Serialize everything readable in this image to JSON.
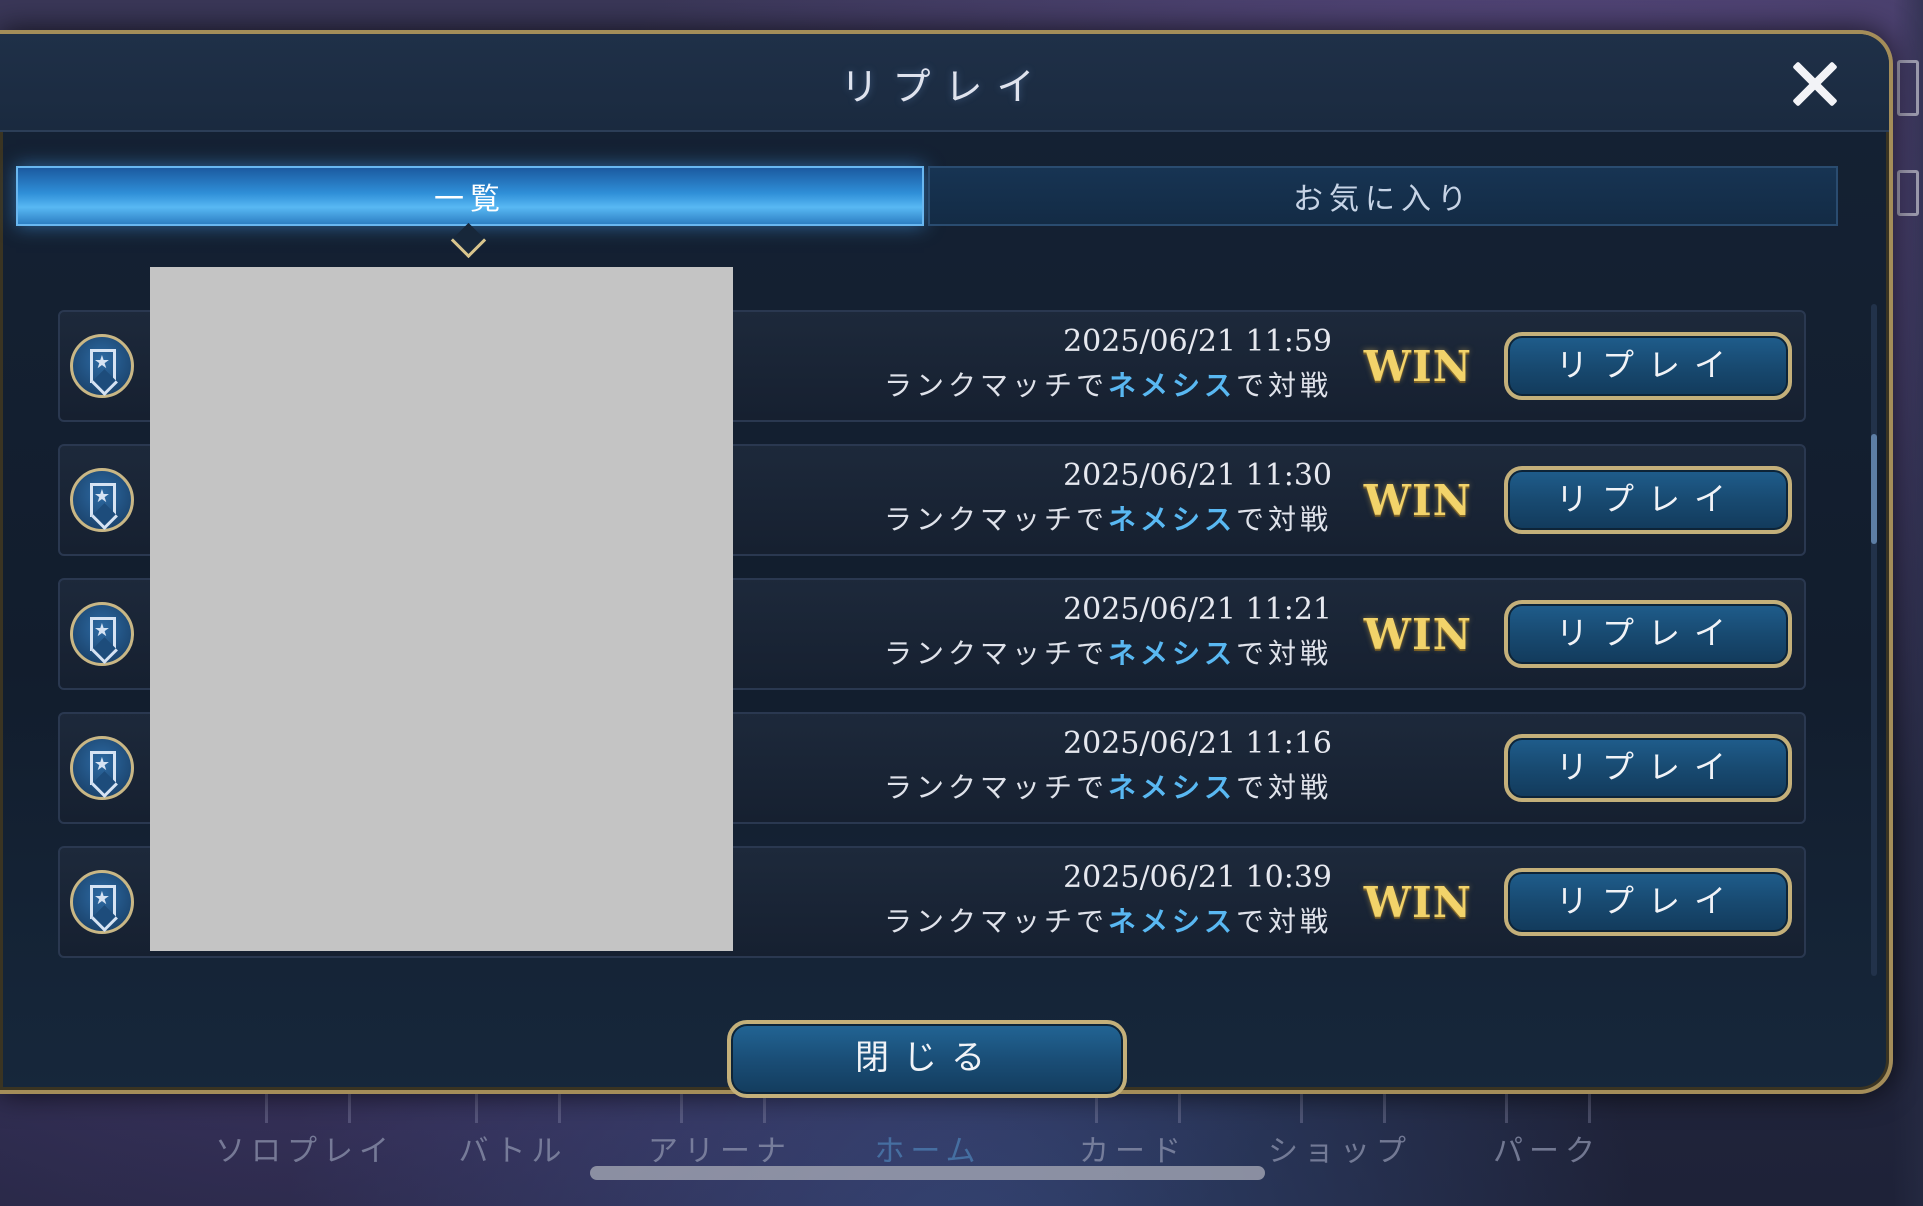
{
  "modal": {
    "title": "リプレイ",
    "close_icon": "close-icon",
    "tabs": [
      {
        "label": "一覧",
        "active": true
      },
      {
        "label": "お気に入り",
        "active": false
      }
    ],
    "rows": [
      {
        "date": "2025/06/21 11:59",
        "desc_prefix": "ランクマッチで",
        "desc_highlight": "ネメシス",
        "desc_suffix": "で対戦",
        "result": "WIN",
        "button": "リプレイ"
      },
      {
        "date": "2025/06/21 11:30",
        "desc_prefix": "ランクマッチで",
        "desc_highlight": "ネメシス",
        "desc_suffix": "で対戦",
        "result": "WIN",
        "button": "リプレイ"
      },
      {
        "date": "2025/06/21 11:21",
        "desc_prefix": "ランクマッチで",
        "desc_highlight": "ネメシス",
        "desc_suffix": "で対戦",
        "result": "WIN",
        "button": "リプレイ"
      },
      {
        "date": "2025/06/21 11:16",
        "desc_prefix": "ランクマッチで",
        "desc_highlight": "ネメシス",
        "desc_suffix": "で対戦",
        "result": "",
        "button": "リプレイ"
      },
      {
        "date": "2025/06/21 10:39",
        "desc_prefix": "ランクマッチで",
        "desc_highlight": "ネメシス",
        "desc_suffix": "で対戦",
        "result": "WIN",
        "button": "リプレイ"
      }
    ],
    "close_button": "閉じる"
  },
  "background_nav": [
    {
      "label": "ソロプレイ",
      "active": false
    },
    {
      "label": "バトル",
      "active": false
    },
    {
      "label": "アリーナ",
      "active": false
    },
    {
      "label": "ホーム",
      "active": true
    },
    {
      "label": "カード",
      "active": false
    },
    {
      "label": "ショップ",
      "active": false
    },
    {
      "label": "パーク",
      "active": false
    }
  ],
  "colors": {
    "accent_blue": "#2f8fd8",
    "gold_border": "#c4b07a",
    "win_gold": "#f2d36a",
    "highlight_blue": "#59b8f2"
  }
}
